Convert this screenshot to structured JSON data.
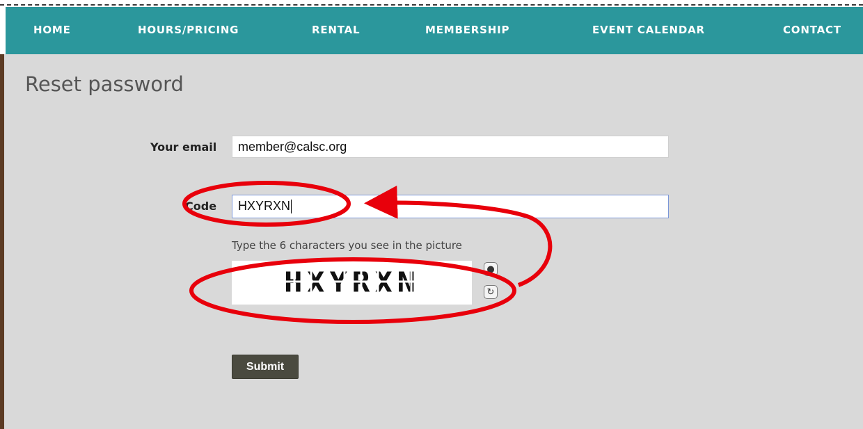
{
  "nav": {
    "items": [
      {
        "label": "HOME"
      },
      {
        "label": "HOURS/PRICING"
      },
      {
        "label": "RENTAL"
      },
      {
        "label": "MEMBERSHIP"
      },
      {
        "label": "EVENT CALENDAR"
      },
      {
        "label": "CONTACT"
      }
    ],
    "background_color": "#2b979c"
  },
  "page": {
    "title": "Reset password"
  },
  "form": {
    "email_label": "Your email",
    "email_value": "member@calsc.org",
    "code_label": "Code",
    "code_value": "HXYRXN",
    "captcha_instructions": "Type the 6 characters you see in the picture",
    "captcha_text": "HXYRXN",
    "captcha_audio_icon": "audio-icon",
    "captcha_refresh_icon": "refresh-icon",
    "submit_label": "Submit"
  },
  "annotation_color": "#e8000b"
}
